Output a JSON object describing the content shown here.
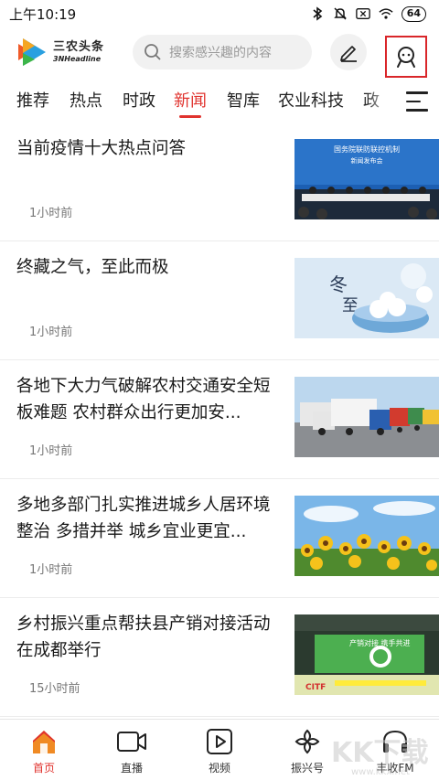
{
  "status_bar": {
    "time": "上午10:19",
    "icons": [
      "bluetooth-icon",
      "mute-icon",
      "sim-icon",
      "wifi-icon"
    ],
    "battery": "64"
  },
  "header": {
    "logo_cn": "三农头条",
    "logo_en": "3NHeadline",
    "search_placeholder": "搜索感兴趣的内容",
    "accent_color": "#e0332e"
  },
  "tabs": [
    {
      "label": "推荐"
    },
    {
      "label": "热点"
    },
    {
      "label": "时政"
    },
    {
      "label": "新闻",
      "active": true
    },
    {
      "label": "智库"
    },
    {
      "label": "农业科技"
    },
    {
      "label": "政"
    }
  ],
  "feed": [
    {
      "title": "当前疫情十大热点问答",
      "time": "1小时前",
      "thumb_heading": "国务院联防联控机制",
      "thumb_sub": "新闻发布会"
    },
    {
      "title": "终藏之气，至此而极",
      "time": "1小时前",
      "thumb_heading": "冬",
      "thumb_sub": "至"
    },
    {
      "title": "各地下大力气破解农村交通安全短板难题 农村群众出行更加安...",
      "time": "1小时前"
    },
    {
      "title": "多地多部门扎实推进城乡人居环境整治 多措并举 城乡宜业更宜...",
      "time": "1小时前"
    },
    {
      "title": "乡村振兴重点帮扶县产销对接活动在成都举行",
      "time": "15小时前",
      "thumb_heading": "产销对接 携手共进",
      "thumb_sub": "CITF"
    }
  ],
  "bottom_nav": [
    {
      "label": "首页",
      "icon": "home-icon",
      "active": true
    },
    {
      "label": "直播",
      "icon": "camera-icon"
    },
    {
      "label": "视频",
      "icon": "play-icon"
    },
    {
      "label": "振兴号",
      "icon": "revitalize-icon"
    },
    {
      "label": "丰收FM",
      "icon": "headphones-icon"
    }
  ],
  "watermark": {
    "text": "KK下载",
    "url": "www.kkx.net"
  }
}
